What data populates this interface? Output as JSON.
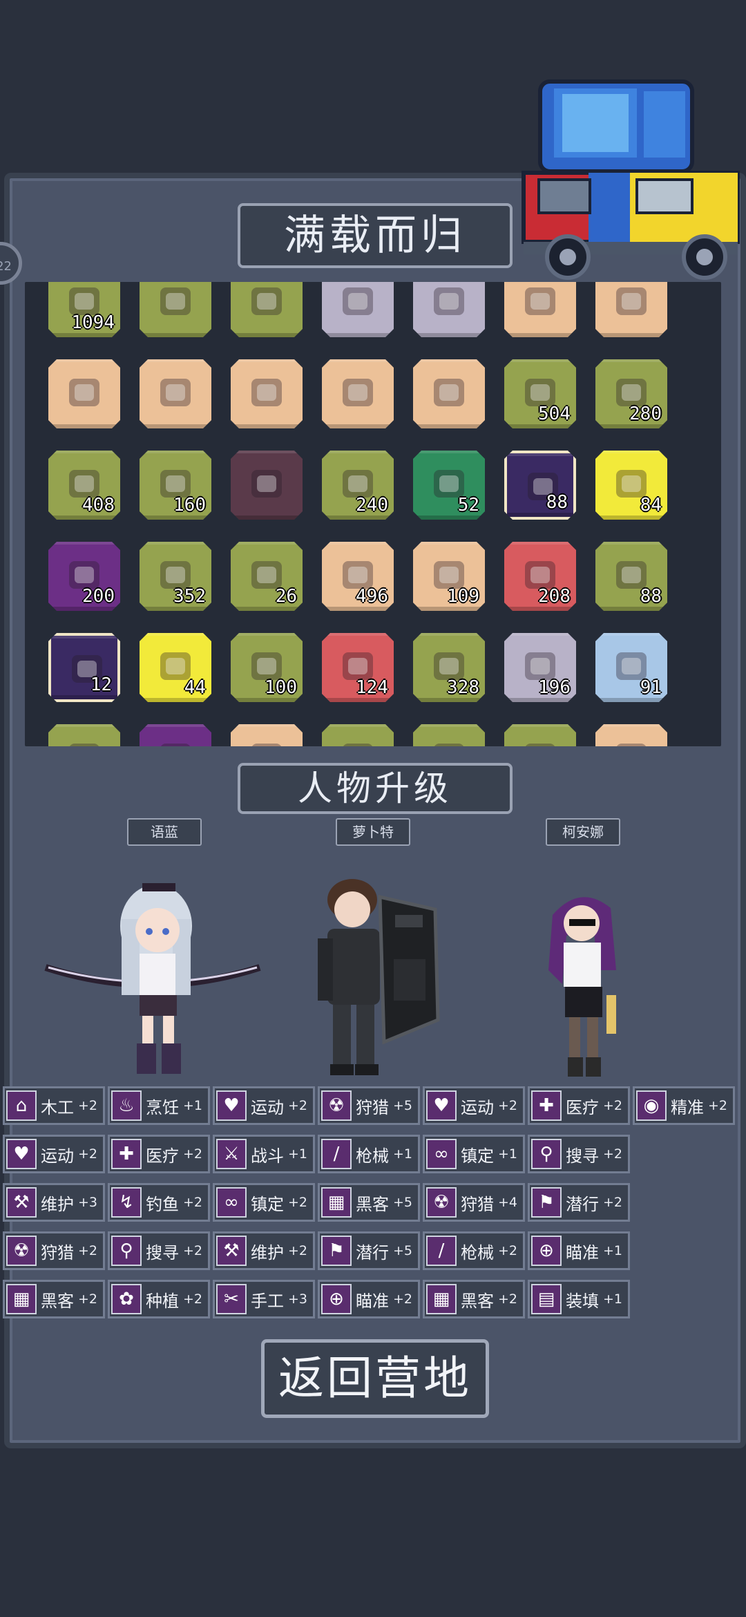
{
  "loot_title": "满载而归",
  "upgrade_title": "人物升级",
  "return_button": "返回营地",
  "side_badge": "22",
  "inventory": [
    {
      "icon": "supplies-icon",
      "color": "olive",
      "qty": "1094"
    },
    {
      "icon": "sack-icon",
      "color": "olive",
      "qty": ""
    },
    {
      "icon": "sack-icon",
      "color": "olive",
      "qty": ""
    },
    {
      "icon": "laptop-icon",
      "color": "gray",
      "qty": ""
    },
    {
      "icon": "laptop-icon",
      "color": "gray",
      "qty": ""
    },
    {
      "icon": "kunai-icon",
      "color": "tan",
      "qty": ""
    },
    {
      "icon": "kunai-icon",
      "color": "tan",
      "qty": ""
    },
    {
      "icon": "kunai-icon",
      "color": "tan",
      "qty": ""
    },
    {
      "icon": "kunai-icon",
      "color": "tan",
      "qty": ""
    },
    {
      "icon": "kunai-icon",
      "color": "tan",
      "qty": ""
    },
    {
      "icon": "kunai-icon",
      "color": "tan",
      "qty": ""
    },
    {
      "icon": "kunai-icon",
      "color": "tan",
      "qty": ""
    },
    {
      "icon": "meat-icon",
      "color": "olive",
      "qty": "504"
    },
    {
      "icon": "chair-icon",
      "color": "olive",
      "qty": "280"
    },
    {
      "icon": "egg-icon",
      "color": "olive",
      "qty": "408"
    },
    {
      "icon": "milk-bottle-icon",
      "color": "olive",
      "qty": "160"
    },
    {
      "icon": "blades-icon",
      "color": "dark",
      "qty": ""
    },
    {
      "icon": "cloth-icon",
      "color": "olive",
      "qty": "240"
    },
    {
      "icon": "log-icon",
      "color": "green",
      "qty": "52"
    },
    {
      "icon": "blueprint-syringe-icon",
      "color": "navy",
      "qty": "88"
    },
    {
      "icon": "potion-icon",
      "color": "yellow",
      "qty": "84"
    },
    {
      "icon": "shirt-icon",
      "color": "purple",
      "qty": "200"
    },
    {
      "icon": "chili-icon",
      "color": "olive",
      "qty": "352"
    },
    {
      "icon": "herb-icon",
      "color": "olive",
      "qty": "26"
    },
    {
      "icon": "wire-icon",
      "color": "tan",
      "qty": "496"
    },
    {
      "icon": "stone-icon",
      "color": "tan",
      "qty": "109"
    },
    {
      "icon": "medkit-icon",
      "color": "red",
      "qty": "208"
    },
    {
      "icon": "canned-meat-icon",
      "color": "olive",
      "qty": "88"
    },
    {
      "icon": "blueprint-icon",
      "color": "navy",
      "qty": "12"
    },
    {
      "icon": "whiskey-icon",
      "color": "yellow",
      "qty": "44"
    },
    {
      "icon": "magazine-icon",
      "color": "olive",
      "qty": "100"
    },
    {
      "icon": "bullets-icon",
      "color": "red",
      "qty": "124"
    },
    {
      "icon": "apple-icon",
      "color": "olive",
      "qty": "328"
    },
    {
      "icon": "battery-icon",
      "color": "gray",
      "qty": "196"
    },
    {
      "icon": "circuit-icon",
      "color": "blue",
      "qty": "91"
    },
    {
      "icon": "bag-icon",
      "color": "olive",
      "qty": ""
    },
    {
      "icon": "plate-icon",
      "color": "purple",
      "qty": ""
    },
    {
      "icon": "orange-item-icon",
      "color": "tan",
      "qty": ""
    },
    {
      "icon": "item-icon",
      "color": "olive",
      "qty": ""
    },
    {
      "icon": "item-icon",
      "color": "olive",
      "qty": ""
    },
    {
      "icon": "item-icon",
      "color": "olive",
      "qty": ""
    },
    {
      "icon": "item-icon",
      "color": "tan",
      "qty": ""
    }
  ],
  "characters": [
    {
      "name": "语蓝",
      "sprite": "archer-girl-sprite"
    },
    {
      "name": "萝卜特",
      "sprite": "riot-shield-soldier-sprite"
    },
    {
      "name": "柯安娜",
      "sprite": "office-lady-sprite"
    }
  ],
  "skill_rows": [
    [
      {
        "icon": "house-icon",
        "glyph": "⌂",
        "name": "木工",
        "bonus": "+2"
      },
      {
        "icon": "cooking-pot-icon",
        "glyph": "♨",
        "name": "烹饪",
        "bonus": "+1"
      },
      {
        "icon": "heart-icon",
        "glyph": "♥",
        "name": "运动",
        "bonus": "+2"
      },
      {
        "icon": "radiation-icon",
        "glyph": "☢",
        "name": "狩猎",
        "bonus": "+5"
      },
      {
        "icon": "heart-icon",
        "glyph": "♥",
        "name": "运动",
        "bonus": "+2"
      },
      {
        "icon": "medkit-icon",
        "glyph": "✚",
        "name": "医疗",
        "bonus": "+2"
      },
      {
        "icon": "eye-icon",
        "glyph": "◉",
        "name": "精准",
        "bonus": "+2"
      }
    ],
    [
      {
        "icon": "heart-icon",
        "glyph": "♥",
        "name": "运动",
        "bonus": "+2"
      },
      {
        "icon": "medkit-icon",
        "glyph": "✚",
        "name": "医疗",
        "bonus": "+2"
      },
      {
        "icon": "sword-icon",
        "glyph": "⚔",
        "name": "战斗",
        "bonus": "+1"
      },
      {
        "icon": "knife-icon",
        "glyph": "∕",
        "name": "枪械",
        "bonus": "+1"
      },
      {
        "icon": "glasses-icon",
        "glyph": "∞",
        "name": "镇定",
        "bonus": "+1"
      },
      {
        "icon": "magnifier-icon",
        "glyph": "⚲",
        "name": "搜寻",
        "bonus": "+2"
      }
    ],
    [
      {
        "icon": "wrench-icon",
        "glyph": "⚒",
        "name": "维护",
        "bonus": "+3"
      },
      {
        "icon": "fishing-icon",
        "glyph": "↯",
        "name": "钓鱼",
        "bonus": "+2"
      },
      {
        "icon": "glasses-icon",
        "glyph": "∞",
        "name": "镇定",
        "bonus": "+2"
      },
      {
        "icon": "circuit-icon",
        "glyph": "▦",
        "name": "黑客",
        "bonus": "+5"
      },
      {
        "icon": "radiation-icon",
        "glyph": "☢",
        "name": "狩猎",
        "bonus": "+4"
      },
      {
        "icon": "sneak-icon",
        "glyph": "⚑",
        "name": "潜行",
        "bonus": "+2"
      }
    ],
    [
      {
        "icon": "radiation-icon",
        "glyph": "☢",
        "name": "狩猎",
        "bonus": "+2"
      },
      {
        "icon": "magnifier-icon",
        "glyph": "⚲",
        "name": "搜寻",
        "bonus": "+2"
      },
      {
        "icon": "wrench-icon",
        "glyph": "⚒",
        "name": "维护",
        "bonus": "+2"
      },
      {
        "icon": "sneak-icon",
        "glyph": "⚑",
        "name": "潜行",
        "bonus": "+5"
      },
      {
        "icon": "knife-icon",
        "glyph": "∕",
        "name": "枪械",
        "bonus": "+2"
      },
      {
        "icon": "crosshair-icon",
        "glyph": "⊕",
        "name": "瞄准",
        "bonus": "+1"
      }
    ],
    [
      {
        "icon": "circuit-icon",
        "glyph": "▦",
        "name": "黑客",
        "bonus": "+2"
      },
      {
        "icon": "plant-icon",
        "glyph": "✿",
        "name": "种植",
        "bonus": "+2"
      },
      {
        "icon": "scissors-icon",
        "glyph": "✂",
        "name": "手工",
        "bonus": "+3"
      },
      {
        "icon": "crosshair-icon",
        "glyph": "⊕",
        "name": "瞄准",
        "bonus": "+2"
      },
      {
        "icon": "circuit-icon",
        "glyph": "▦",
        "name": "黑客",
        "bonus": "+2"
      },
      {
        "icon": "reload-icon",
        "glyph": "▤",
        "name": "装填",
        "bonus": "+1"
      }
    ]
  ]
}
